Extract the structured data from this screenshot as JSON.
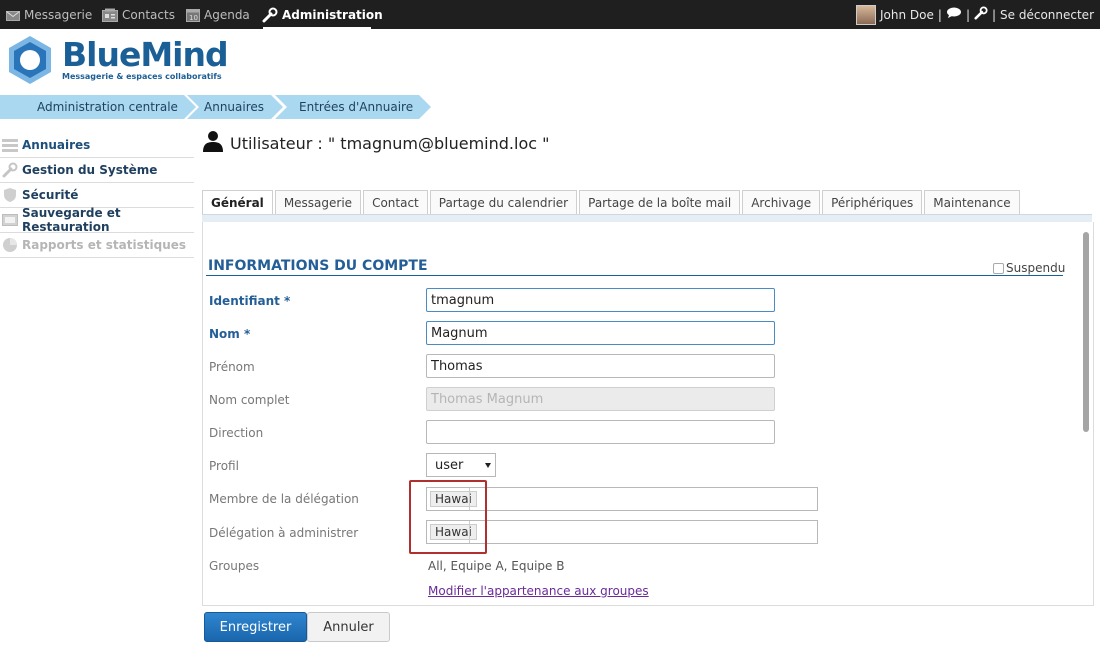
{
  "topbar": {
    "nav": [
      {
        "label": "Messagerie",
        "icon": "mail-icon"
      },
      {
        "label": "Contacts",
        "icon": "contacts-icon"
      },
      {
        "label": "Agenda",
        "icon": "calendar-icon"
      },
      {
        "label": "Administration",
        "icon": "wrench-icon",
        "active": true
      }
    ],
    "user": {
      "name": "John Doe",
      "separator": "|",
      "chat_icon": "chat-icon",
      "settings_icon": "wrench-icon",
      "logout": "Se déconnecter"
    }
  },
  "logo": {
    "name": "BlueMind",
    "tagline": "Messagerie & espaces collaboratifs",
    "color": "#1b5f97"
  },
  "breadcrumb": [
    "Administration centrale",
    "Annuaires",
    "Entrées d'Annuaire"
  ],
  "sidebar": [
    {
      "label": "Annuaires",
      "icon": "list-icon"
    },
    {
      "label": "Gestion du Système",
      "icon": "wrench-icon"
    },
    {
      "label": "Sécurité",
      "icon": "shield-icon"
    },
    {
      "label": "Sauvegarde et Restauration",
      "icon": "backup-icon"
    },
    {
      "label": "Rapports et statistiques",
      "icon": "chart-icon",
      "disabled": true
    }
  ],
  "page": {
    "title": "Utilisateur : \" tmagnum@bluemind.loc \"",
    "icon": "user-icon"
  },
  "tabs": [
    "Général",
    "Messagerie",
    "Contact",
    "Partage du calendrier",
    "Partage de la boîte mail",
    "Archivage",
    "Périphériques",
    "Maintenance"
  ],
  "active_tab": "Général",
  "section": {
    "title": "INFORMATIONS DU COMPTE",
    "suspend_label": "Suspendu",
    "suspended": false
  },
  "form": {
    "identifiant": {
      "label": "Identifiant *",
      "value": "tmagnum"
    },
    "nom": {
      "label": "Nom *",
      "value": "Magnum"
    },
    "prenom": {
      "label": "Prénom",
      "value": "Thomas"
    },
    "nom_complet": {
      "label": "Nom complet",
      "value": "Thomas Magnum"
    },
    "direction": {
      "label": "Direction",
      "value": ""
    },
    "profil": {
      "label": "Profil",
      "value": "user"
    },
    "membre_delegation": {
      "label": "Membre de la délégation",
      "tag": "Hawai"
    },
    "delegation_admin": {
      "label": "Délégation à administrer",
      "tag": "Hawai"
    },
    "groupes": {
      "label": "Groupes",
      "value": "All, Equipe A, Equipe B",
      "link": "Modifier l'appartenance aux groupes"
    }
  },
  "buttons": {
    "save": "Enregistrer",
    "cancel": "Annuler"
  },
  "colors": {
    "accent": "#1b5f97",
    "breadcrumb": "#a9d8f0",
    "highlight": "#b03030",
    "save_button": "#1a66ad"
  }
}
